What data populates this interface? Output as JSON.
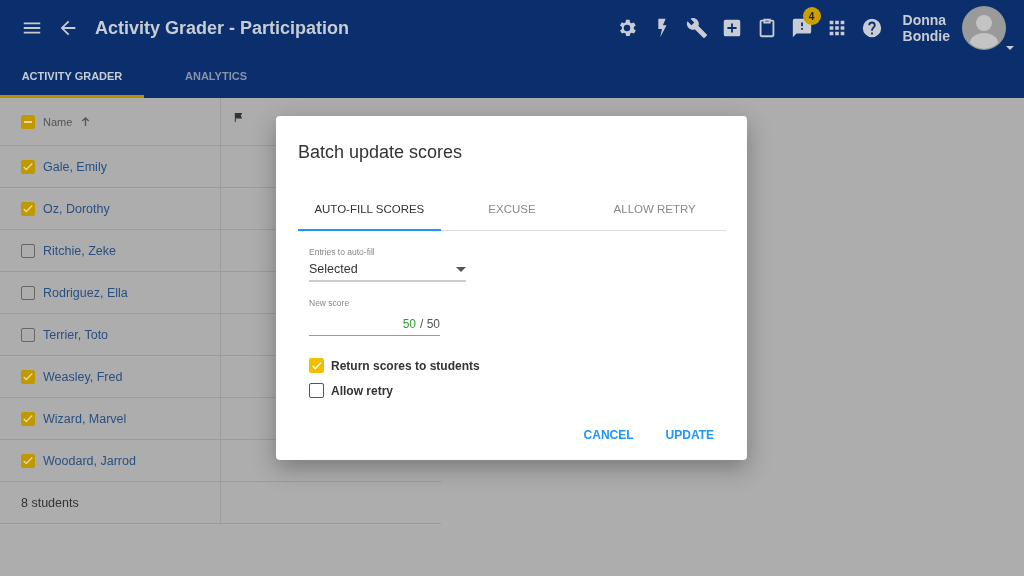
{
  "app_bar": {
    "title": "Activity Grader - Participation",
    "notification_count": "4",
    "user_name": [
      "Donna",
      "Bondie"
    ]
  },
  "tabs": [
    {
      "label": "ACTIVITY GRADER",
      "selected": true
    },
    {
      "label": "ANALYTICS",
      "selected": false
    }
  ],
  "table": {
    "select_all": {
      "indeterminate": true
    },
    "name_header": "Name",
    "rows": [
      {
        "name": "Gale, Emily",
        "checked": true
      },
      {
        "name": "Oz, Dorothy",
        "checked": true
      },
      {
        "name": "Ritchie, Zeke",
        "checked": false
      },
      {
        "name": "Rodriguez, Ella",
        "checked": false
      },
      {
        "name": "Terrier, Toto",
        "checked": false
      },
      {
        "name": "Weasley, Fred",
        "checked": true
      },
      {
        "name": "Wizard, Marvel",
        "checked": true
      },
      {
        "name": "Woodard, Jarrod",
        "checked": true
      }
    ],
    "footer": "8 students"
  },
  "dialog": {
    "title": "Batch update scores",
    "tabs": [
      {
        "label": "AUTO-FILL SCORES",
        "selected": true
      },
      {
        "label": "EXCUSE",
        "selected": false
      },
      {
        "label": "ALLOW RETRY",
        "selected": false
      }
    ],
    "entries_field": {
      "label": "Entries to auto-fill",
      "value": "Selected"
    },
    "score_field": {
      "label": "New score",
      "value": "50",
      "max": "/ 50"
    },
    "options": [
      {
        "label": "Return scores to students",
        "checked": true
      },
      {
        "label": "Allow retry",
        "checked": false
      }
    ],
    "buttons": [
      "CANCEL",
      "UPDATE"
    ]
  }
}
